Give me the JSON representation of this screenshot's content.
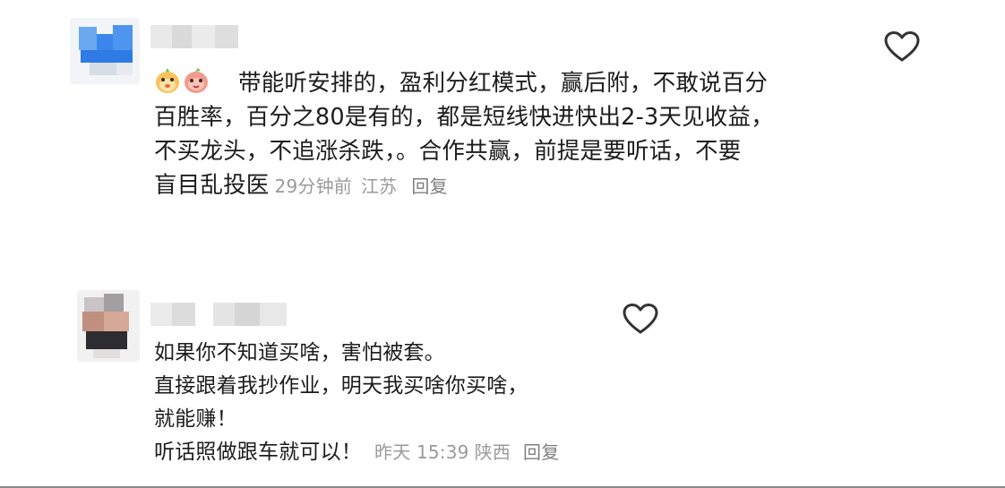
{
  "comments": [
    {
      "emoji_icons": [
        "monkey-face-emoji",
        "peach-face-emoji"
      ],
      "lines": [
        "带能听安排的，盈利分红模式，赢后附，不敢说百分",
        "百胜率，百分之80是有的，都是短线快进快出2-3天见收益，",
        "不买龙头，不追涨杀跌，。合作共赢，前提是要听话，不要",
        "盲目乱投医"
      ],
      "time": "29分钟前",
      "location": "江苏",
      "reply_label": "回复",
      "like_icon": "heart-outline-icon",
      "avatar_color": "#4a90e8"
    },
    {
      "lines": [
        "如果你不知道买啥，害怕被套。",
        "直接跟着我抄作业，明天我买啥你买啥，",
        "就能赚！",
        "听话照做跟车就可以！"
      ],
      "time": "昨天 15:39",
      "location": "陕西",
      "reply_label": "回复",
      "like_icon": "heart-outline-icon",
      "avatar_color": "#b07a6a"
    }
  ]
}
